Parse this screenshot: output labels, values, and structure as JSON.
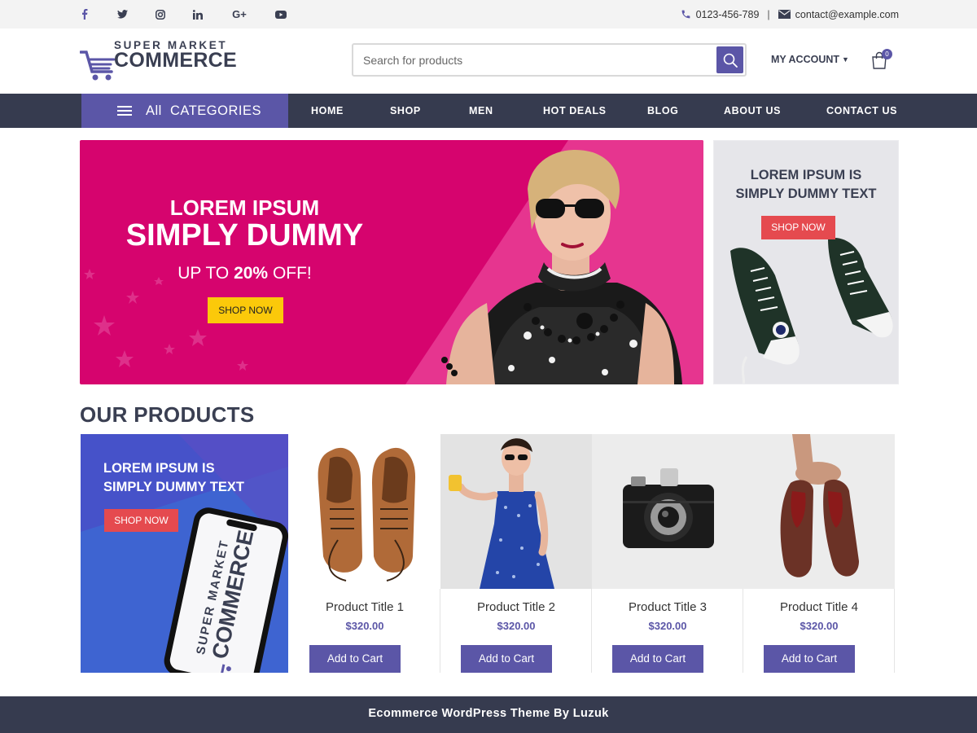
{
  "colors": {
    "primary": "#5b56a7",
    "dark_nav": "#363b4f",
    "hero_pink": "#d6046e",
    "yellow_button": "#fbc90a",
    "red_button": "#e54a4f",
    "promo_blue": "#4652c9"
  },
  "topbar": {
    "social_icons": [
      "facebook-icon",
      "twitter-icon",
      "instagram-icon",
      "linkedin-icon",
      "google-plus-icon",
      "youtube-icon"
    ],
    "phone": "0123-456-789",
    "separator": "|",
    "email": "contact@example.com"
  },
  "header": {
    "logo_tagline": "SUPER MARKET",
    "logo_brand": "COMMERCE",
    "search_placeholder": "Search for products",
    "account_label": "MY ACCOUNT",
    "cart_count": "0"
  },
  "nav": {
    "all_label": "All",
    "categories_label": "CATEGORIES",
    "items": [
      "HOME",
      "SHOP",
      "MEN",
      "HOT DEALS",
      "BLOG",
      "ABOUT US",
      "CONTACT US"
    ]
  },
  "hero": {
    "line1": "LOREM IPSUM",
    "line2": "SIMPLY DUMMY",
    "line3_prefix": "UP TO ",
    "line3_bold": "20%",
    "line3_suffix": " OFF!",
    "button": "SHOP NOW"
  },
  "side_banner": {
    "title_line1": "LOREM IPSUM IS",
    "title_line2": "SIMPLY DUMMY TEXT",
    "button": "SHOP NOW"
  },
  "products_section": {
    "title": "OUR PRODUCTS",
    "promo": {
      "title_line1": "LOREM IPSUM IS",
      "title_line2": "SIMPLY DUMMY TEXT",
      "button": "SHOP NOW",
      "phone_tagline": "SUPER MARKET",
      "phone_brand": "COMMERCE"
    },
    "products": [
      {
        "title": "Product Title 1",
        "price": "$320.00",
        "button": "Add to Cart"
      },
      {
        "title": "Product Title 2",
        "price": "$320.00",
        "button": "Add to Cart"
      },
      {
        "title": "Product Title 3",
        "price": "$320.00",
        "button": "Add to Cart"
      },
      {
        "title": "Product Title 4",
        "price": "$320.00",
        "button": "Add to Cart"
      }
    ]
  },
  "footer": {
    "text": "Ecommerce WordPress Theme By Luzuk"
  }
}
